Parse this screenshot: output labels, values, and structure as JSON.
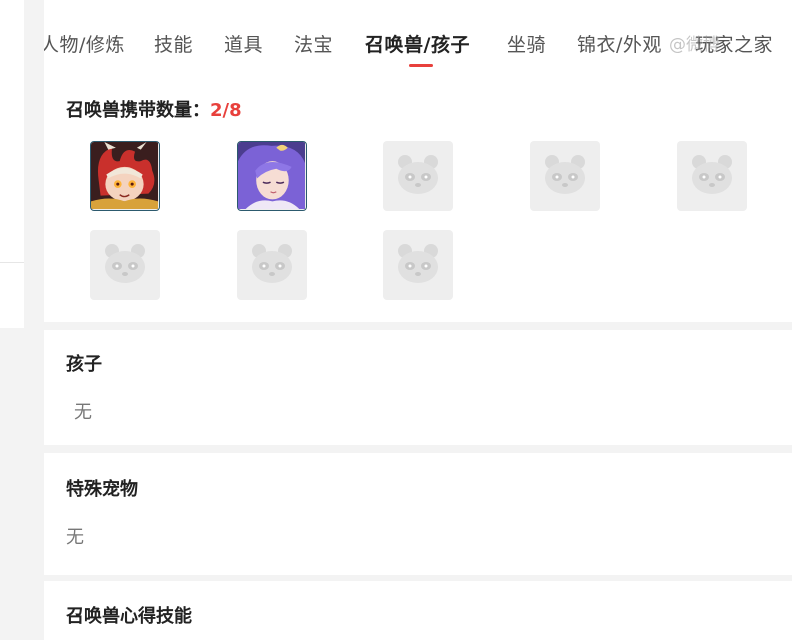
{
  "tabs": [
    {
      "label": "人物/修炼"
    },
    {
      "label": "技能"
    },
    {
      "label": "道具"
    },
    {
      "label": "法宝"
    },
    {
      "label": "召唤兽/孩子"
    },
    {
      "label": "坐骑"
    },
    {
      "label": "锦衣/外观"
    },
    {
      "label": "玩家之家"
    }
  ],
  "active_tab": "召唤兽/孩子",
  "watermark": "@微博",
  "summons": {
    "count_label": "召唤兽携带数量：",
    "count_value": "2/8",
    "slots": [
      {
        "state": "filled",
        "icon": "fire-demon-pet-avatar"
      },
      {
        "state": "filled",
        "icon": "purple-hair-pet-avatar"
      },
      {
        "state": "empty",
        "icon": "panda-placeholder-icon"
      },
      {
        "state": "empty",
        "icon": "panda-placeholder-icon"
      },
      {
        "state": "empty",
        "icon": "panda-placeholder-icon"
      },
      {
        "state": "empty",
        "icon": "panda-placeholder-icon"
      },
      {
        "state": "empty",
        "icon": "panda-placeholder-icon"
      },
      {
        "state": "empty",
        "icon": "panda-placeholder-icon"
      }
    ]
  },
  "child": {
    "title": "孩子",
    "value": "无"
  },
  "special_pet": {
    "title": "特殊宠物",
    "value": "无"
  },
  "summon_skills": {
    "title": "召唤兽心得技能"
  },
  "colors": {
    "accent": "#e8403c",
    "page_bg": "#f3f3f3",
    "card_bg": "#ffffff",
    "placeholder_bg": "#eeeeee"
  }
}
